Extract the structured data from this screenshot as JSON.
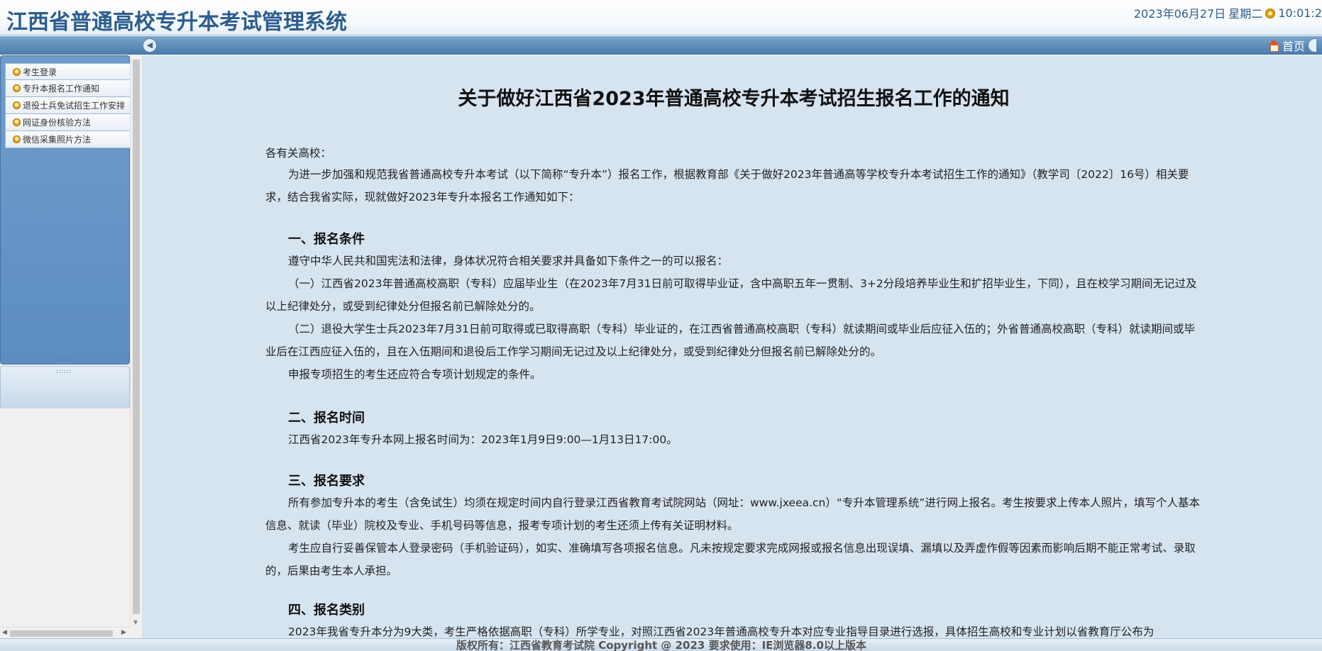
{
  "header": {
    "system_title": "江西省普通高校专升本考试管理系统",
    "date": "2023年06月27日",
    "weekday": "星期二",
    "time": "10:01:2"
  },
  "navbar": {
    "home_label": "首页"
  },
  "sidebar": {
    "items": [
      {
        "label": "考生登录"
      },
      {
        "label": "专升本报名工作通知"
      },
      {
        "label": "退役士兵免试招生工作安排"
      },
      {
        "label": "网证身份核验方法"
      },
      {
        "label": "微信采集照片方法"
      }
    ]
  },
  "document": {
    "title": "关于做好江西省2023年普通高校专升本考试招生报名工作的通知",
    "salutation": "各有关高校：",
    "intro": "为进一步加强和规范我省普通高校专升本考试（以下简称“专升本”）报名工作，根据教育部《关于做好2023年普通高等学校专升本考试招生工作的通知》（教学司〔2022〕16号）相关要求，结合我省实际，现就做好2023年专升本报名工作通知如下：",
    "section1_heading": "一、报名条件",
    "section1_p1": "遵守中华人民共和国宪法和法律，身体状况符合相关要求并具备如下条件之一的可以报名：",
    "section1_p2": "（一）江西省2023年普通高校高职（专科）应届毕业生（在2023年7月31日前可取得毕业证，含中高职五年一贯制、3+2分段培养毕业生和扩招毕业生，下同），且在校学习期间无记过及以上纪律处分，或受到纪律处分但报名前已解除处分的。",
    "section1_p3": "（二）退役大学生士兵2023年7月31日前可取得或已取得高职（专科）毕业证的，在江西省普通高校高职（专科）就读期间或毕业后应征入伍的；外省普通高校高职（专科）就读期间或毕业后在江西应征入伍的，且在入伍期间和退役后工作学习期间无记过及以上纪律处分，或受到纪律处分但报名前已解除处分的。",
    "section1_p4": "申报专项招生的考生还应符合专项计划规定的条件。",
    "section2_heading": "二、报名时间",
    "section2_p1": "江西省2023年专升本网上报名时间为：2023年1月9日9:00—1月13日17:00。",
    "section3_heading": "三、报名要求",
    "section3_p1": "所有参加专升本的考生（含免试生）均须在规定时间内自行登录江西省教育考试院网站（网址：www.jxeea.cn）“专升本管理系统”进行网上报名。考生按要求上传本人照片，填写个人基本信息、就读（毕业）院校及专业、手机号码等信息，报考专项计划的考生还须上传有关证明材料。",
    "section3_p2": "考生应自行妥善保管本人登录密码（手机验证码），如实、准确填写各项报名信息。凡未按规定要求完成网报或报名信息出现误填、漏填以及弄虚作假等因素而影响后期不能正常考试、录取的，后果由考生本人承担。",
    "section4_heading": "四、报名类别",
    "section4_p1": "2023年我省专升本分为9大类，考生严格依据高职（专科）所学专业，对照江西省2023年普通高校专升本对应专业指导目录进行选报，具体招生高校和专业计划以省教育厅公布为"
  },
  "footer": {
    "text": "版权所有：江西省教育考试院 Copyright @ 2023 要求使用：IE浏览器8.0以上版本"
  }
}
